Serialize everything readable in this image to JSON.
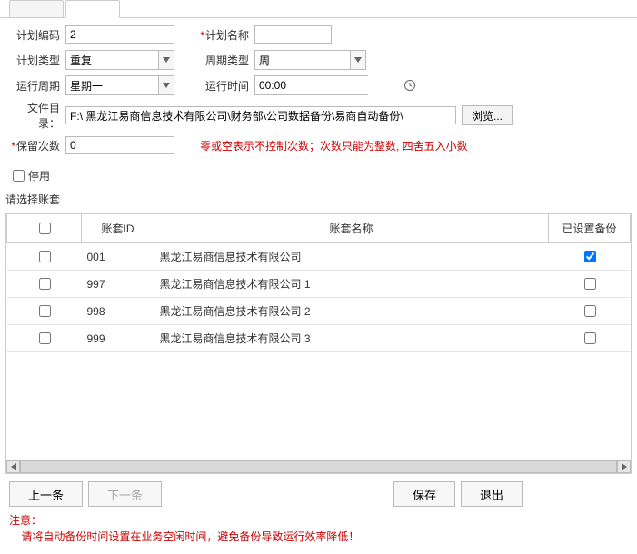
{
  "form": {
    "plan_code_label": "计划编码",
    "plan_code_value": "2",
    "plan_name_label": "计划名称",
    "plan_name_value": "",
    "plan_type_label": "计划类型",
    "plan_type_value": "重复",
    "cycle_type_label": "周期类型",
    "cycle_type_value": "周",
    "run_cycle_label": "运行周期",
    "run_cycle_value": "星期一",
    "run_time_label": "运行时间",
    "run_time_value": "00:00",
    "file_dir_label": "文件目录：",
    "file_dir_value": "F:\\ 黑龙江易商信息技术有限公司\\财务部\\公司数据备份\\易商自动备份\\",
    "browse_label": "浏览...",
    "keep_count_label": "保留次数",
    "keep_count_value": "0",
    "keep_count_hint": "零或空表示不控制次数；次数只能为整数, 四舍五入小数",
    "disable_label": "停用"
  },
  "section_label": "请选择账套",
  "table": {
    "headers": {
      "id": "账套ID",
      "name": "账套名称",
      "set": "已设置备份"
    },
    "rows": [
      {
        "id": "001",
        "name": "黑龙江易商信息技术有限公司",
        "checked": false,
        "set": true
      },
      {
        "id": "997",
        "name": "黑龙江易商信息技术有限公司 1",
        "checked": false,
        "set": false
      },
      {
        "id": "998",
        "name": "黑龙江易商信息技术有限公司 2",
        "checked": false,
        "set": false
      },
      {
        "id": "999",
        "name": "黑龙江易商信息技术有限公司 3",
        "checked": false,
        "set": false
      }
    ]
  },
  "footer": {
    "prev": "上一条",
    "next": "下一条",
    "save": "保存",
    "exit": "退出"
  },
  "note": {
    "title": "注意：",
    "body": "请将自动备份时间设置在业务空闲时间，避免备份导致运行效率降低！"
  }
}
